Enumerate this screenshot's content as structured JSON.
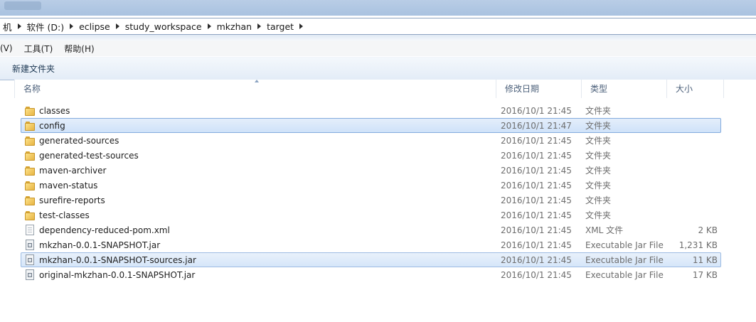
{
  "address": {
    "crumbs": [
      "机",
      "软件 (D:)",
      "eclipse",
      "study_workspace",
      "mkzhan",
      "target"
    ]
  },
  "menubar": {
    "items": [
      "(V)",
      "工具(T)",
      "帮助(H)"
    ]
  },
  "toolbar": {
    "new_folder_label": "新建文件夹"
  },
  "columns": {
    "name": "名称",
    "date": "修改日期",
    "type": "类型",
    "size": "大小"
  },
  "files": [
    {
      "name": "classes",
      "date": "2016/10/1 21:45",
      "type": "文件夹",
      "size": "",
      "icon": "folder-icon",
      "state": ""
    },
    {
      "name": "config",
      "date": "2016/10/1 21:47",
      "type": "文件夹",
      "size": "",
      "icon": "folder-icon",
      "state": "selected"
    },
    {
      "name": "generated-sources",
      "date": "2016/10/1 21:45",
      "type": "文件夹",
      "size": "",
      "icon": "folder-icon",
      "state": ""
    },
    {
      "name": "generated-test-sources",
      "date": "2016/10/1 21:45",
      "type": "文件夹",
      "size": "",
      "icon": "folder-icon",
      "state": ""
    },
    {
      "name": "maven-archiver",
      "date": "2016/10/1 21:45",
      "type": "文件夹",
      "size": "",
      "icon": "folder-icon",
      "state": ""
    },
    {
      "name": "maven-status",
      "date": "2016/10/1 21:45",
      "type": "文件夹",
      "size": "",
      "icon": "folder-icon",
      "state": ""
    },
    {
      "name": "surefire-reports",
      "date": "2016/10/1 21:45",
      "type": "文件夹",
      "size": "",
      "icon": "folder-icon",
      "state": ""
    },
    {
      "name": "test-classes",
      "date": "2016/10/1 21:45",
      "type": "文件夹",
      "size": "",
      "icon": "folder-icon",
      "state": ""
    },
    {
      "name": "dependency-reduced-pom.xml",
      "date": "2016/10/1 21:45",
      "type": "XML 文件",
      "size": "2 KB",
      "icon": "xml-file-icon",
      "state": ""
    },
    {
      "name": "mkzhan-0.0.1-SNAPSHOT.jar",
      "date": "2016/10/1 21:45",
      "type": "Executable Jar File",
      "size": "1,231 KB",
      "icon": "jar-file-icon",
      "state": ""
    },
    {
      "name": "mkzhan-0.0.1-SNAPSHOT-sources.jar",
      "date": "2016/10/1 21:45",
      "type": "Executable Jar File",
      "size": "11 KB",
      "icon": "jar-file-icon",
      "state": "hovered"
    },
    {
      "name": "original-mkzhan-0.0.1-SNAPSHOT.jar",
      "date": "2016/10/1 21:45",
      "type": "Executable Jar File",
      "size": "17 KB",
      "icon": "jar-file-icon",
      "state": ""
    }
  ]
}
